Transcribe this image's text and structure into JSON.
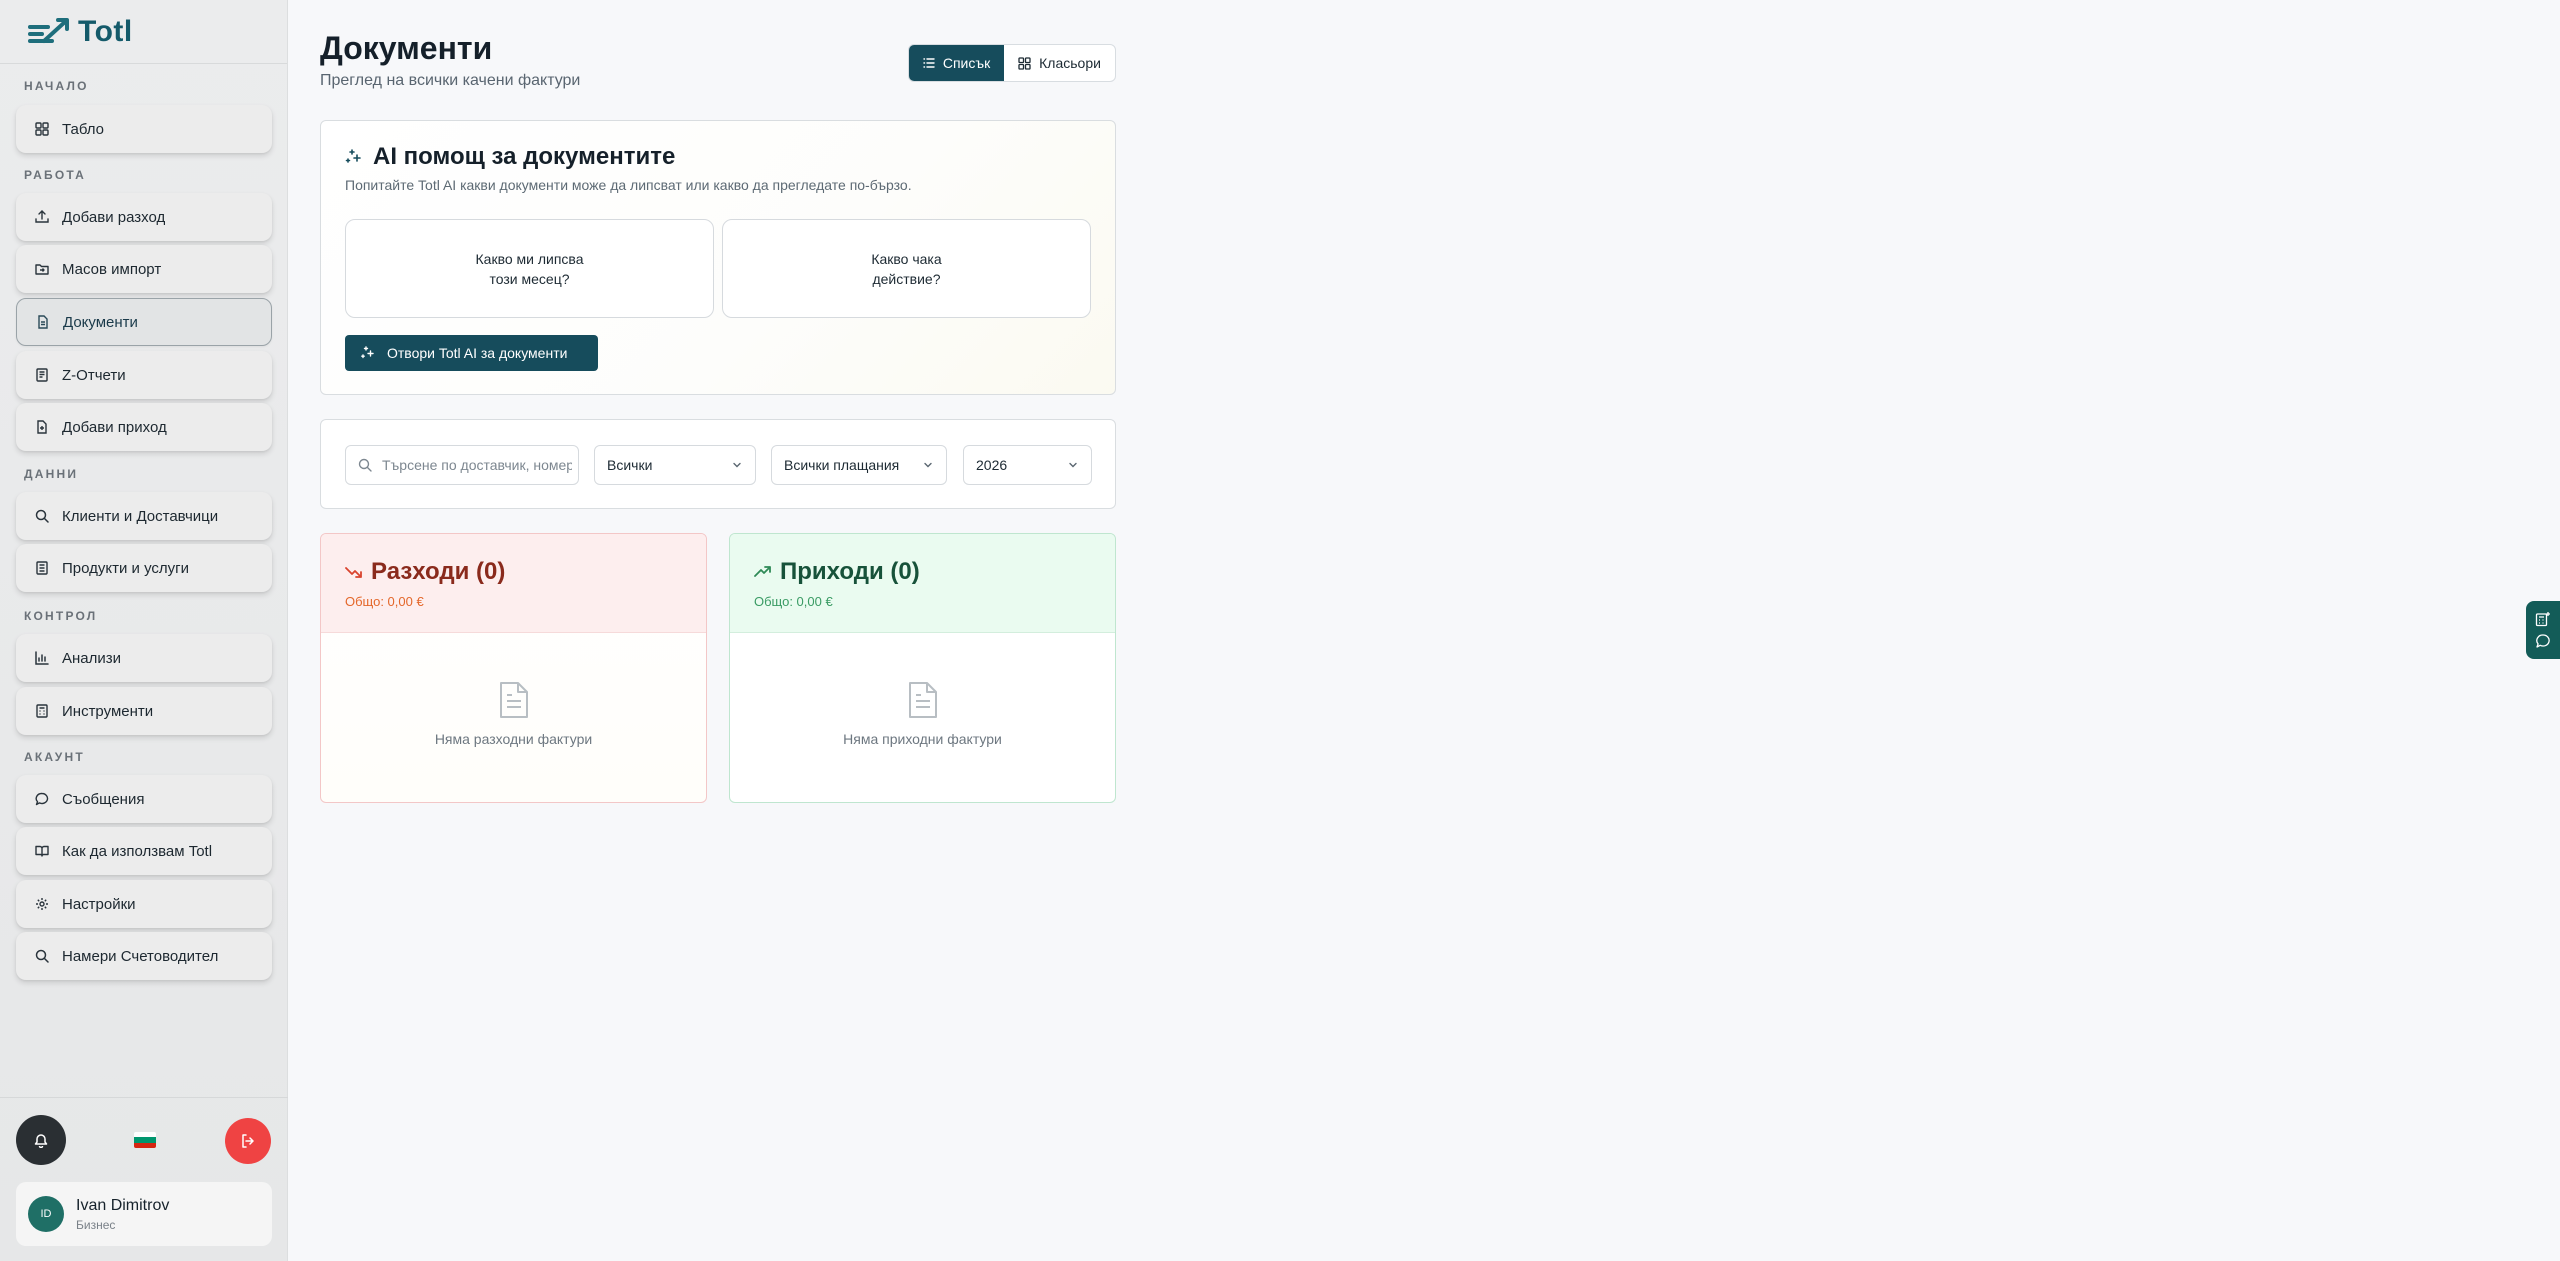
{
  "brand": {
    "name": "Totl"
  },
  "sidebar": {
    "sections": [
      "НАЧАЛО",
      "РАБОТА",
      "ДАННИ",
      "КОНТРОЛ",
      "АКАУНТ"
    ],
    "items": [
      {
        "label": "Табло",
        "icon": "dashboard-icon"
      },
      {
        "label": "Добави разход",
        "icon": "upload-icon"
      },
      {
        "label": "Масов импорт",
        "icon": "folder-import-icon"
      },
      {
        "label": "Документи",
        "icon": "document-icon",
        "active": true
      },
      {
        "label": "Z-Отчети",
        "icon": "receipt-icon"
      },
      {
        "label": "Добави приход",
        "icon": "file-plus-icon"
      },
      {
        "label": "Клиенти и Доставчици",
        "icon": "search-icon"
      },
      {
        "label": "Продукти и услуги",
        "icon": "list-icon"
      },
      {
        "label": "Анализи",
        "icon": "bar-chart-icon"
      },
      {
        "label": "Инструменти",
        "icon": "calculator-icon"
      },
      {
        "label": "Съобщения",
        "icon": "message-icon"
      },
      {
        "label": "Как да използвам Totl",
        "icon": "book-icon"
      },
      {
        "label": "Настройки",
        "icon": "gear-icon"
      },
      {
        "label": "Намери Счетоводител",
        "icon": "search-icon"
      }
    ]
  },
  "user": {
    "initials": "ID",
    "name": "Ivan Dimitrov",
    "plan": "Бизнес"
  },
  "page": {
    "title": "Документи",
    "subtitle": "Преглед на всички качени фактури"
  },
  "view_toggle": {
    "list_label": "Списък",
    "folders_label": "Класьори",
    "selected": "list"
  },
  "ai": {
    "title": "AI помощ за документите",
    "subtitle": "Попитайте Totl AI какви документи може да липсват или какво да прегледате по-бързо.",
    "q1_line1": "Какво ми липсва",
    "q1_line2": "този месец?",
    "q2_line1": "Какво чака",
    "q2_line2": "действие?",
    "open_label": "Отвори Totl AI за документи"
  },
  "filters": {
    "search_placeholder": "Търсене по доставчик, номер...",
    "type_value": "Всички",
    "payment_value": "Всички плащания",
    "year_value": "2026"
  },
  "expenses": {
    "title": "Разходи (0)",
    "total": "Общо: 0,00 €",
    "empty": "Няма разходни фактури",
    "color": "#8a2a1c"
  },
  "incomes": {
    "title": "Приходи (0)",
    "total": "Общо: 0,00 €",
    "empty": "Няма приходни фактури",
    "color": "#17523a"
  },
  "colors": {
    "accent": "#164c5c",
    "danger": "#ef4343"
  }
}
